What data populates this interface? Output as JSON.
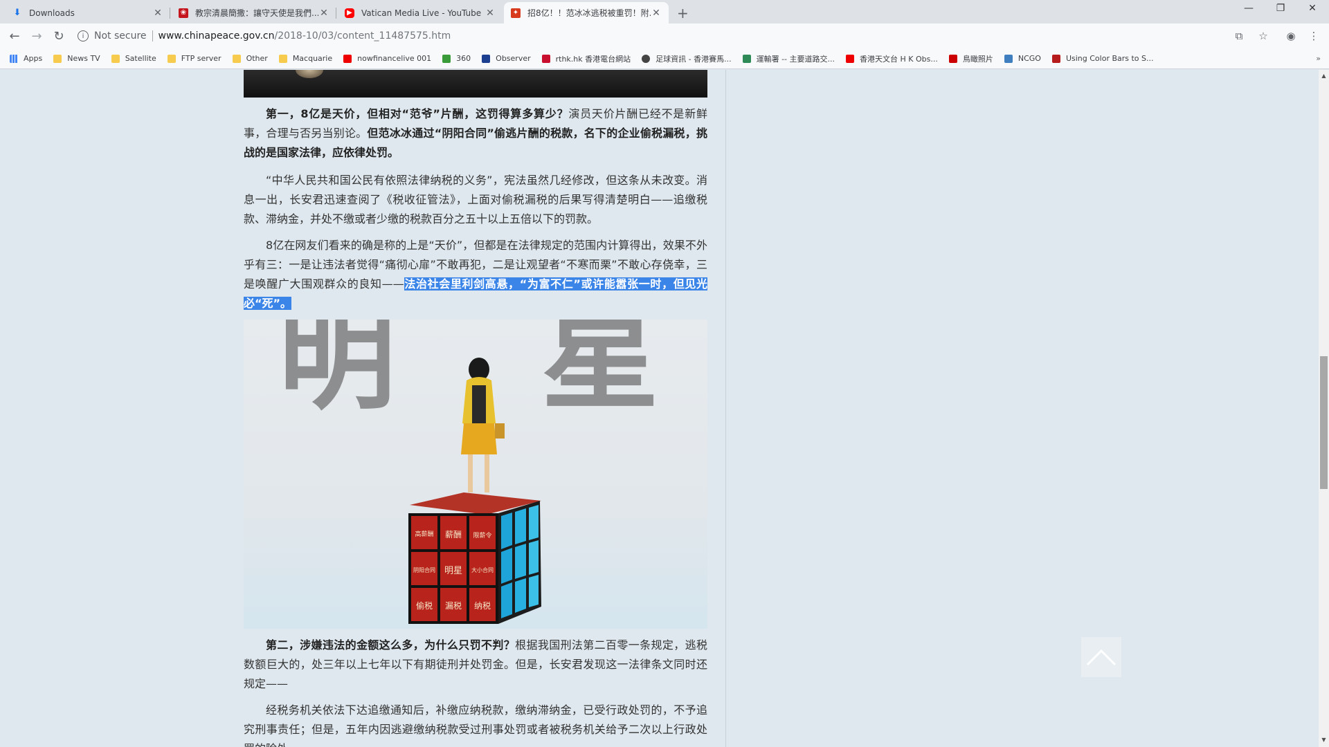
{
  "tabs": [
    {
      "title": "Downloads"
    },
    {
      "title": "教宗清晨簡撒：讓守天使是我們..."
    },
    {
      "title": "Vatican Media Live - YouTube"
    },
    {
      "title": "招8亿！！范冰冰逃税被重罚！附..."
    }
  ],
  "new_tab_label": "+",
  "window": {
    "minimize": "—",
    "restore": "❐",
    "close": "✕"
  },
  "toolbar": {
    "not_secure": "Not secure",
    "url_host": "www.chinapeace.gov.cn",
    "url_path": "/2018-10/03/content_11487575.htm"
  },
  "bookmarks": [
    {
      "label": "Apps",
      "icon": "apps-grid-icon"
    },
    {
      "label": "News TV",
      "icon": "folder-icon"
    },
    {
      "label": "Satellite",
      "icon": "folder-icon"
    },
    {
      "label": "FTP server",
      "icon": "folder-icon"
    },
    {
      "label": "Other",
      "icon": "folder-icon"
    },
    {
      "label": "Macquarie",
      "icon": "folder-icon"
    },
    {
      "label": "nowfinancelive 001",
      "icon": "youtube-icon"
    },
    {
      "label": "360",
      "icon": "site-icon"
    },
    {
      "label": "Observer",
      "icon": "site-icon"
    },
    {
      "label": "rthk.hk 香港電台網站",
      "icon": "site-icon"
    },
    {
      "label": "足球資訊 - 香港賽馬...",
      "icon": "site-icon"
    },
    {
      "label": "運輸署 -- 主要道路交...",
      "icon": "site-icon"
    },
    {
      "label": "香港天文台 H K Obs...",
      "icon": "youtube-icon"
    },
    {
      "label": "鳥瞰照片",
      "icon": "site-icon"
    },
    {
      "label": "NCGO",
      "icon": "site-icon"
    },
    {
      "label": "Using Color Bars to S...",
      "icon": "site-icon"
    }
  ],
  "bookmarks_more": "»",
  "article": {
    "p1_bold": "第一，8亿是天价，但相对“范爷”片酬，这罚得算多算少？",
    "p1_text": "演员天价片酬已经不是新鲜事，合理与否另当别论。",
    "p1_bold2": "但范冰冰通过“阴阳合同”偷逃片酬的税款，名下的企业偷税漏税，挑战的是国家法律，应依律处罚。",
    "p2": "“中华人民共和国公民有依照法律纳税的义务”，宪法虽然几经修改，但这条从未改变。消息一出，长安君迅速查阅了《税收征管法》，上面对偷税漏税的后果写得清楚明白——追缴税款、滞纳金，并处不缴或者少缴的税款百分之五十以上五倍以下的罚款。",
    "p3_text": "8亿在网友们看来的确是称的上是“天价”，但都是在法律规定的范围内计算得出，效果不外乎有三：一是让违法者觉得“痛彻心扉”不敢再犯，二是让观望者“不寒而栗”不敢心存侥幸，三是唤醒广大围观群众的良知——",
    "p3_highlight": "法治社会里利剑高悬，“为富不仁”或许能嚣张一时，但见光必“死”。",
    "p4_bold": "第二，涉嫌违法的金额这么多，为什么只罚不判？",
    "p4_text": "根据我国刑法第二百零一条规定，逃税数额巨大的，处三年以上七年以下有期徒刑并处罚金。但是，长安君发现这一法律条文同时还规定——",
    "p5": "经税务机关依法下达追缴通知后，补缴应纳税款，缴纳滞纳金，已受行政处罚的，不予追究刑事责任；但是，五年内因逃避缴纳税款受过刑事处罚或者被税务机关给予二次以上行政处罚的除外。"
  },
  "image": {
    "bg_char_left": "明",
    "bg_char_right": "星",
    "cube_labels": [
      "高薪酬",
      "薪酬",
      "限薪令",
      "阴阳合同",
      "明星",
      "大小合同",
      "偷税",
      "漏税",
      "纳税"
    ]
  }
}
